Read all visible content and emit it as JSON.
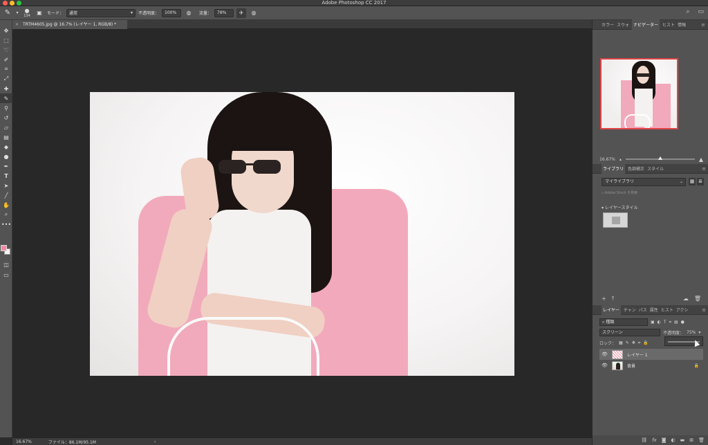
{
  "app": {
    "title": "Adobe Photoshop CC 2017"
  },
  "options": {
    "brush_size": "134",
    "mode_label": "モード：",
    "mode_value": "通常",
    "opacity_label": "不透明度：",
    "opacity_value": "100%",
    "flow_label": "流量：",
    "flow_value": "78%"
  },
  "document": {
    "tab_title": "TRTM4605.jpg @ 16.7% (レイヤー 1, RGB/8) *"
  },
  "status": {
    "zoom": "16.67%",
    "file_info": "ファイル：86.1M/95.1M"
  },
  "panels": {
    "top_tabs": [
      "カラー",
      "スウォ",
      "ナビゲーター",
      "ヒスト",
      "情報"
    ],
    "active_top_tab": "ナビゲーター",
    "navigator_zoom": "16.67%",
    "library_tabs": [
      "ライブラリ",
      "色調補正",
      "スタイル"
    ],
    "library_dropdown": "マイライブラリ",
    "library_search_placeholder": "Adobe Stock を検索",
    "library_section": "▾ レイヤースタイル",
    "layer_tabs": [
      "レイヤー",
      "チャン",
      "パス",
      "属性",
      "ヒスト",
      "アクシ"
    ],
    "kind_filter": "種類",
    "blend_mode": "スクリーン",
    "layer_opacity_label": "不透明度：",
    "layer_opacity_value": "75%",
    "lock_label": "ロック：",
    "layers": [
      {
        "name": "レイヤー 1"
      },
      {
        "name": "背景"
      }
    ]
  },
  "colors": {
    "foreground": "#f28aa6",
    "background": "#f5f5f5",
    "accent": "#e24444"
  }
}
